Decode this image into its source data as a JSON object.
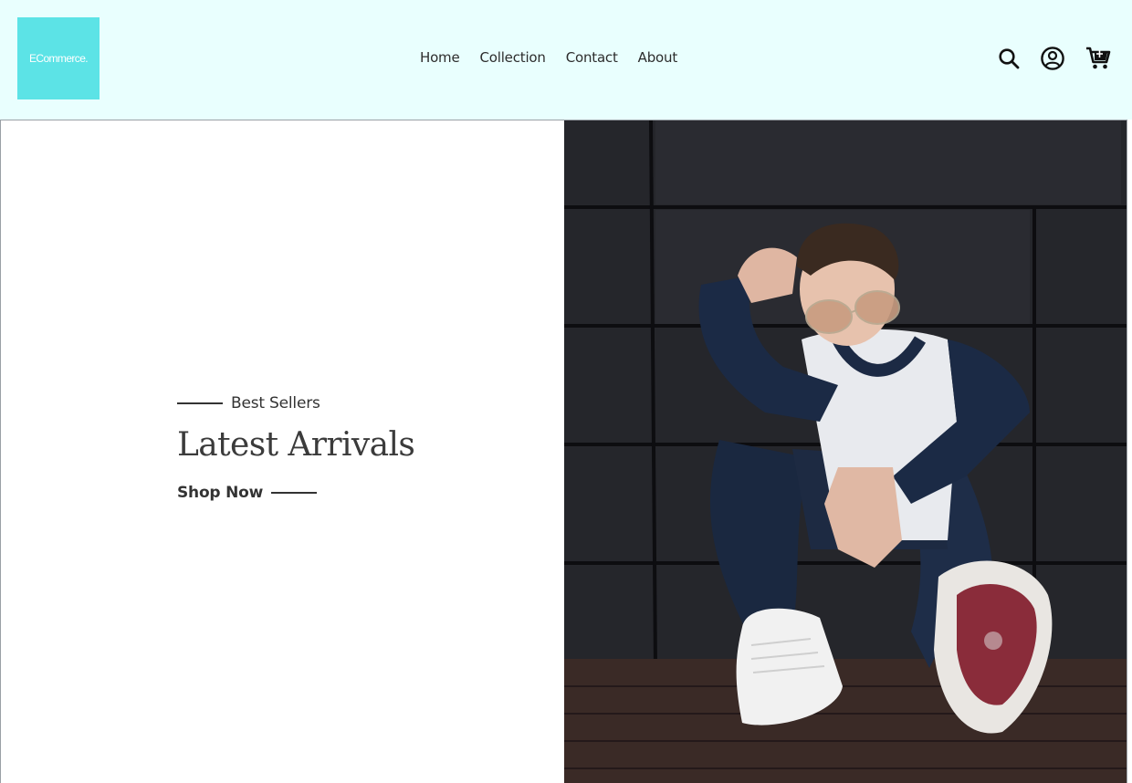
{
  "header": {
    "logo_text": "ECommerce."
  },
  "nav": {
    "items": [
      {
        "label": "Home"
      },
      {
        "label": "Collection"
      },
      {
        "label": "Contact"
      },
      {
        "label": "About"
      }
    ]
  },
  "header_icons": [
    "search-icon",
    "user-icon",
    "cart-icon"
  ],
  "hero": {
    "subtitle": "Best Sellers",
    "title": "Latest Arrivals",
    "cta_label": "Shop Now",
    "image_description_icon": "hero-photo"
  },
  "colors": {
    "header_bg": "#e9fffe",
    "logo_bg": "#5ce3e6",
    "text": "#333333"
  }
}
